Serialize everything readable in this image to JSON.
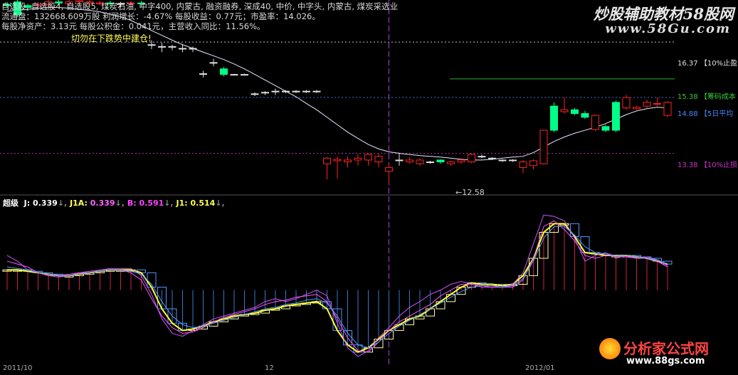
{
  "info": {
    "line1": "自选股, 自选股4, 自选股5, 煤炭石油, 中字400, 内蒙古, 融资融券, 深成40, 中价, 中字头, 内蒙古, 煤炭采选业",
    "line2": "流通盘：132668.609万股  利润增长：-4.67%  每股收益：0.77元；市盈率：14.026。",
    "line3": "每股净资产：3.13元  每股公积金：0.041元，主营收入同比：11.56%。",
    "warning": "切勿在下跌势中建仓!"
  },
  "watermark": {
    "top": "炒股辅助教材58股网",
    "top_url": "www.58Gu.com",
    "bottom": "分析家公式网",
    "bottom_url": "www.88gs.com"
  },
  "price_levels": [
    {
      "value": "16.37",
      "label": "【10%止盈",
      "color": "#e0e0e0",
      "dashed": true
    },
    {
      "value": "15.38",
      "label": "【筹码成本",
      "color": "#33cc33",
      "dashed": false
    },
    {
      "value": "14.88",
      "label": "【5日平均",
      "color": "#4488ff",
      "dashed": true
    },
    {
      "value": "13.38",
      "label": "【10%止损",
      "color": "#cc33cc",
      "dashed": true
    }
  ],
  "low_marker": "12.58",
  "indicator": {
    "name": "超级",
    "j_label": "J:",
    "j_value": "0.339",
    "j1a_label": "J1A:",
    "j1a_value": "0.339",
    "b_label": "B:",
    "b_value": "0.591",
    "j1_label": "J1:",
    "j1_value": "0.514"
  },
  "x_ticks": [
    "2011/10",
    "12",
    "2012/01"
  ],
  "colors": {
    "up": "#ff2222",
    "down": "#00ff88",
    "ma": "#e8e8ff",
    "cursor": "#b040d0"
  },
  "chart_data": {
    "type": "candlestick",
    "y_range": [
      12.3,
      17.5
    ],
    "cursor_index": 37,
    "candles": [
      {
        "o": 17.38,
        "c": 17.35,
        "h": 17.45,
        "l": 17.3
      },
      {
        "o": 17.45,
        "c": 17.1,
        "h": 17.5,
        "l": 17.05
      },
      {
        "o": 17.35,
        "c": 17.3,
        "h": 17.4,
        "l": 17.2
      },
      {
        "o": 17.35,
        "c": 17.38,
        "h": 17.45,
        "l": 17.3
      },
      {
        "o": 17.38,
        "c": 17.45,
        "h": 17.5,
        "l": 17.3
      },
      {
        "o": 17.45,
        "c": 17.42,
        "h": 17.5,
        "l": 17.35
      },
      {
        "o": 17.4,
        "c": 17.45,
        "h": 17.5,
        "l": 17.35
      },
      {
        "o": 17.45,
        "c": 17.48,
        "h": 17.5,
        "l": 17.4
      },
      {
        "o": 17.42,
        "c": 17.45,
        "h": 17.5,
        "l": 17.35
      },
      {
        "o": 17.4,
        "c": 17.42,
        "h": 17.48,
        "l": 17.35
      },
      {
        "o": 17.42,
        "c": 17.4,
        "h": 17.48,
        "l": 17.3
      },
      {
        "o": 17.38,
        "c": 17.4,
        "h": 17.45,
        "l": 17.3
      },
      {
        "o": 17.4,
        "c": 17.42,
        "h": 17.48,
        "l": 17.3
      },
      {
        "o": 17.42,
        "c": 17.4,
        "h": 17.48,
        "l": 17.3
      },
      {
        "o": 16.3,
        "c": 16.3,
        "h": 16.42,
        "l": 16.18
      },
      {
        "o": 16.25,
        "c": 16.25,
        "h": 16.35,
        "l": 16.1
      },
      {
        "o": 16.25,
        "c": 16.25,
        "h": 16.3,
        "l": 16.15
      },
      {
        "o": 16.2,
        "c": 16.2,
        "h": 16.3,
        "l": 16.1
      },
      {
        "o": 16.2,
        "c": 16.2,
        "h": 16.25,
        "l": 16.1
      },
      {
        "o": 15.52,
        "c": 15.52,
        "h": 15.6,
        "l": 15.42
      },
      {
        "o": 15.82,
        "c": 15.82,
        "h": 15.92,
        "l": 15.72
      },
      {
        "o": 15.65,
        "c": 15.5,
        "h": 15.7,
        "l": 15.45
      },
      {
        "o": 15.5,
        "c": 15.5,
        "h": 15.52,
        "l": 15.5
      },
      {
        "o": 15.5,
        "c": 15.5,
        "h": 15.52,
        "l": 15.5
      },
      {
        "o": 14.98,
        "c": 14.98,
        "h": 15.02,
        "l": 14.92
      },
      {
        "o": 15.02,
        "c": 15.0,
        "h": 15.05,
        "l": 14.95
      },
      {
        "o": 15.05,
        "c": 15.05,
        "h": 15.12,
        "l": 14.95
      },
      {
        "o": 15.05,
        "c": 15.05,
        "h": 15.08,
        "l": 15.0
      },
      {
        "o": 15.05,
        "c": 15.05,
        "h": 15.08,
        "l": 15.0
      },
      {
        "o": 15.05,
        "c": 15.05,
        "h": 15.08,
        "l": 15.0
      },
      {
        "o": 15.05,
        "c": 15.05,
        "h": 15.08,
        "l": 15.0
      },
      {
        "o": 13.1,
        "c": 13.25,
        "h": 13.28,
        "l": 12.68
      },
      {
        "o": 13.18,
        "c": 13.22,
        "h": 13.3,
        "l": 12.7
      },
      {
        "o": 13.15,
        "c": 13.2,
        "h": 13.3,
        "l": 13.0
      },
      {
        "o": 13.2,
        "c": 13.25,
        "h": 13.35,
        "l": 13.05
      },
      {
        "o": 13.2,
        "c": 13.35,
        "h": 13.38,
        "l": 13.05
      },
      {
        "o": 13.15,
        "c": 13.3,
        "h": 13.38,
        "l": 13.0
      },
      {
        "o": 12.9,
        "c": 13.0,
        "h": 13.1,
        "l": 12.58
      },
      {
        "o": 13.2,
        "c": 13.2,
        "h": 13.4,
        "l": 13.05
      },
      {
        "o": 13.15,
        "c": 13.2,
        "h": 13.28,
        "l": 13.1
      },
      {
        "o": 13.1,
        "c": 13.2,
        "h": 13.25,
        "l": 13.05
      },
      {
        "o": 13.15,
        "c": 13.15,
        "h": 13.18,
        "l": 13.1
      },
      {
        "o": 13.2,
        "c": 13.15,
        "h": 13.22,
        "l": 13.1
      },
      {
        "o": 13.1,
        "c": 13.15,
        "h": 13.18,
        "l": 13.05
      },
      {
        "o": 13.15,
        "c": 13.2,
        "h": 13.25,
        "l": 13.1
      },
      {
        "o": 13.15,
        "c": 13.35,
        "h": 13.38,
        "l": 13.12
      },
      {
        "o": 13.3,
        "c": 13.3,
        "h": 13.35,
        "l": 13.25
      },
      {
        "o": 13.25,
        "c": 13.25,
        "h": 13.28,
        "l": 13.2
      },
      {
        "o": 13.2,
        "c": 13.2,
        "h": 13.22,
        "l": 13.15
      },
      {
        "o": 13.2,
        "c": 13.2,
        "h": 13.22,
        "l": 13.15
      },
      {
        "o": 13.0,
        "c": 13.15,
        "h": 13.2,
        "l": 12.85
      },
      {
        "o": 13.05,
        "c": 13.18,
        "h": 13.22,
        "l": 12.95
      },
      {
        "o": 13.1,
        "c": 14.0,
        "h": 14.02,
        "l": 13.08
      },
      {
        "o": 14.65,
        "c": 14.0,
        "h": 14.75,
        "l": 13.95
      },
      {
        "o": 14.5,
        "c": 14.55,
        "h": 14.88,
        "l": 14.45
      },
      {
        "o": 14.55,
        "c": 14.45,
        "h": 14.6,
        "l": 14.4
      },
      {
        "o": 14.45,
        "c": 14.35,
        "h": 14.52,
        "l": 14.3
      },
      {
        "o": 14.02,
        "c": 14.4,
        "h": 14.42,
        "l": 13.98
      },
      {
        "o": 14.1,
        "c": 14.0,
        "h": 14.15,
        "l": 13.95
      },
      {
        "o": 14.75,
        "c": 14.0,
        "h": 14.8,
        "l": 13.95
      },
      {
        "o": 14.6,
        "c": 14.88,
        "h": 14.95,
        "l": 14.55
      },
      {
        "o": 14.58,
        "c": 14.62,
        "h": 14.65,
        "l": 14.55
      },
      {
        "o": 14.65,
        "c": 14.75,
        "h": 14.82,
        "l": 14.6
      },
      {
        "o": 14.7,
        "c": 14.72,
        "h": 14.88,
        "l": 14.65
      },
      {
        "o": 14.4,
        "c": 14.75,
        "h": 14.78,
        "l": 14.35
      }
    ],
    "ma": [
      17.2,
      17.22,
      17.25,
      17.28,
      17.3,
      17.3,
      17.28,
      17.25,
      17.22,
      17.18,
      17.12,
      17.05,
      16.95,
      16.82,
      16.68,
      16.55,
      16.42,
      16.3,
      16.2,
      16.1,
      16.0,
      15.9,
      15.78,
      15.65,
      15.5,
      15.35,
      15.2,
      15.05,
      14.9,
      14.72,
      14.55,
      14.35,
      14.15,
      13.95,
      13.78,
      13.62,
      13.5,
      13.42,
      13.38,
      13.35,
      13.32,
      13.3,
      13.28,
      13.25,
      13.22,
      13.2,
      13.2,
      13.22,
      13.25,
      13.28,
      13.3,
      13.4,
      13.55,
      13.7,
      13.82,
      13.92,
      14.0,
      14.08,
      14.18,
      14.3,
      14.42,
      14.52,
      14.58,
      14.62,
      14.6
    ],
    "indicator_series": [
      {
        "name": "J",
        "color": "#ffff33",
        "values": [
          0.62,
          0.62,
          0.61,
          0.6,
          0.59,
          0.58,
          0.58,
          0.59,
          0.6,
          0.61,
          0.62,
          0.62,
          0.62,
          0.6,
          0.5,
          0.35,
          0.25,
          0.2,
          0.21,
          0.23,
          0.26,
          0.28,
          0.3,
          0.31,
          0.32,
          0.34,
          0.35,
          0.37,
          0.38,
          0.39,
          0.4,
          0.35,
          0.2,
          0.1,
          0.05,
          0.08,
          0.14,
          0.2,
          0.24,
          0.28,
          0.3,
          0.35,
          0.4,
          0.45,
          0.5,
          0.53,
          0.52,
          0.52,
          0.51,
          0.52,
          0.58,
          0.7,
          0.88,
          0.94,
          0.94,
          0.85,
          0.74,
          0.73,
          0.72,
          0.72,
          0.72,
          0.71,
          0.7,
          0.68,
          0.66
        ]
      },
      {
        "name": "J1A",
        "color": "#cc55ff",
        "values": [
          0.72,
          0.68,
          0.62,
          0.6,
          0.58,
          0.57,
          0.58,
          0.6,
          0.61,
          0.62,
          0.63,
          0.63,
          0.63,
          0.58,
          0.45,
          0.28,
          0.18,
          0.16,
          0.2,
          0.24,
          0.28,
          0.3,
          0.32,
          0.34,
          0.36,
          0.4,
          0.42,
          0.4,
          0.42,
          0.45,
          0.48,
          0.44,
          0.25,
          0.08,
          0.02,
          0.06,
          0.15,
          0.22,
          0.3,
          0.36,
          0.4,
          0.45,
          0.48,
          0.52,
          0.54,
          0.52,
          0.5,
          0.5,
          0.5,
          0.52,
          0.6,
          0.8,
          1.0,
          0.99,
          0.96,
          0.84,
          0.68,
          0.72,
          0.74,
          0.7,
          0.72,
          0.7,
          0.71,
          0.69,
          0.65
        ]
      },
      {
        "name": "B",
        "color": "#ff55ff",
        "values": [
          0.68,
          0.66,
          0.64,
          0.6,
          0.58,
          0.58,
          0.59,
          0.6,
          0.6,
          0.61,
          0.62,
          0.62,
          0.6,
          0.55,
          0.42,
          0.3,
          0.22,
          0.18,
          0.19,
          0.22,
          0.26,
          0.29,
          0.31,
          0.33,
          0.35,
          0.38,
          0.4,
          0.41,
          0.43,
          0.44,
          0.45,
          0.4,
          0.28,
          0.15,
          0.06,
          0.05,
          0.12,
          0.2,
          0.26,
          0.3,
          0.34,
          0.38,
          0.44,
          0.48,
          0.52,
          0.52,
          0.51,
          0.5,
          0.5,
          0.5,
          0.55,
          0.7,
          0.92,
          0.96,
          0.9,
          0.82,
          0.72,
          0.7,
          0.72,
          0.72,
          0.71,
          0.7,
          0.7,
          0.68,
          0.64
        ]
      },
      {
        "name": "J1",
        "color": "#5599ff",
        "values": [
          0.64,
          0.63,
          0.62,
          0.6,
          0.59,
          0.58,
          0.58,
          0.59,
          0.6,
          0.61,
          0.62,
          0.62,
          0.61,
          0.59,
          0.52,
          0.4,
          0.3,
          0.24,
          0.22,
          0.23,
          0.25,
          0.27,
          0.29,
          0.31,
          0.33,
          0.35,
          0.36,
          0.38,
          0.39,
          0.41,
          0.42,
          0.39,
          0.3,
          0.18,
          0.1,
          0.08,
          0.12,
          0.18,
          0.23,
          0.27,
          0.31,
          0.35,
          0.39,
          0.43,
          0.47,
          0.5,
          0.51,
          0.51,
          0.5,
          0.51,
          0.56,
          0.68,
          0.84,
          0.92,
          0.92,
          0.86,
          0.78,
          0.74,
          0.73,
          0.72,
          0.72,
          0.71,
          0.7,
          0.69,
          0.66
        ]
      }
    ],
    "indicator_range": [
      0.0,
      1.05
    ],
    "indicator_zero_level": 0.48
  }
}
